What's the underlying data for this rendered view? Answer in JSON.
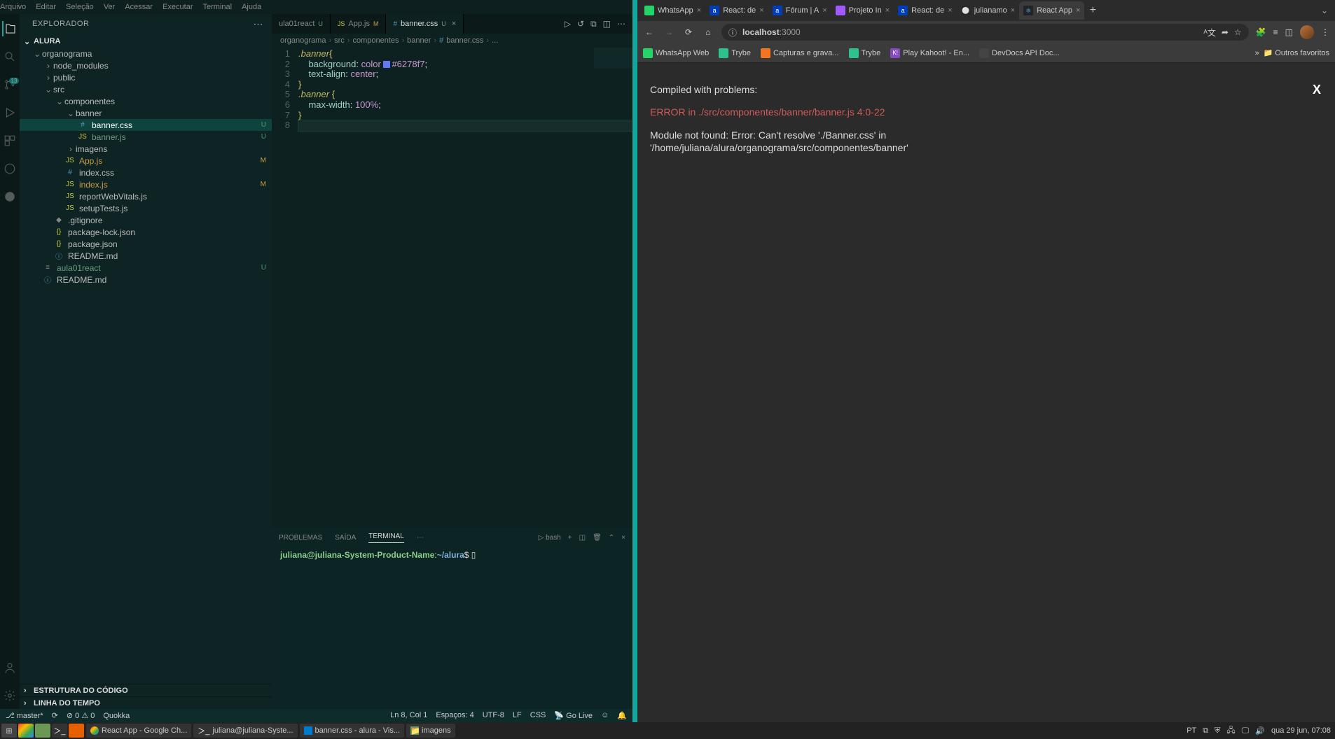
{
  "menubar": [
    "Arquivo",
    "Editar",
    "Seleção",
    "Ver",
    "Acessar",
    "Executar",
    "Terminal",
    "Ajuda"
  ],
  "sidebar": {
    "title": "EXPLORADOR",
    "root": "ALURA",
    "outline": "ESTRUTURA DO CÓDIGO",
    "timeline": "LINHA DO TEMPO"
  },
  "tree": {
    "organograma": "organograma",
    "node_modules": "node_modules",
    "public": "public",
    "src": "src",
    "componentes": "componentes",
    "banner": "banner",
    "bannercss": "banner.css",
    "bannerjs": "banner.js",
    "imagens": "imagens",
    "appjs": "App.js",
    "indexcss": "index.css",
    "indexjs": "index.js",
    "reportweb": "reportWebVitals.js",
    "setuptests": "setupTests.js",
    "gitignore": ".gitignore",
    "packlock": "package-lock.json",
    "packjson": "package.json",
    "readme1": "README.md",
    "aula01": "aula01react",
    "readme2": "README.md"
  },
  "tabs": {
    "t1": {
      "label": "ula01react",
      "badge": "U"
    },
    "t2": {
      "label": "App.js",
      "badge": "M"
    },
    "t3": {
      "label": "banner.css",
      "badge": "U"
    }
  },
  "breadcrumb": [
    "organograma",
    "src",
    "componentes",
    "banner",
    "banner.css",
    "..."
  ],
  "code": {
    "l1_sel": ".banner",
    "l2_prop": "background",
    "l2_col": "color",
    "l2_hex": "#6278f7",
    "l3_prop": "text-align",
    "l3_val": "center",
    "l5_sel": ".banner",
    "l6_prop": "max-width",
    "l6_val": "100%"
  },
  "lines": [
    "1",
    "2",
    "3",
    "4",
    "5",
    "6",
    "7",
    "8"
  ],
  "panel": {
    "problemas": "PROBLEMAS",
    "saida": "SAÍDA",
    "terminal": "TERMINAL",
    "shell": "bash"
  },
  "terminal": {
    "user": "juliana@juliana-System-Product-Name",
    "path": "~/alura"
  },
  "status": {
    "branch": "master*",
    "sync": "⟳",
    "errors": "0",
    "warnings": "0",
    "quokka": "Quokka",
    "pos": "Ln 8, Col 1",
    "spaces": "Espaços: 4",
    "enc": "UTF-8",
    "eol": "LF",
    "lang": "CSS",
    "golive": "Go Live"
  },
  "browserTabs": [
    {
      "label": "WhatsApp",
      "fcolor": "#25d366"
    },
    {
      "label": "React: de",
      "fcolor": "#003eb8"
    },
    {
      "label": "Fórum | A",
      "fcolor": "#003eb8"
    },
    {
      "label": "Projeto In",
      "fcolor": "#a259ff"
    },
    {
      "label": "React: de",
      "fcolor": "#003eb8"
    },
    {
      "label": "julianamo",
      "fcolor": "#fff"
    },
    {
      "label": "React App",
      "fcolor": "#61dafb",
      "active": true
    }
  ],
  "addr": {
    "host": "localhost",
    "port": ":3000"
  },
  "bookmarks": [
    {
      "label": "WhatsApp Web",
      "c": "#25d366"
    },
    {
      "label": "Trybe",
      "c": "#2fc18c"
    },
    {
      "label": "Capturas e grava...",
      "c": "#f47421"
    },
    {
      "label": "Trybe",
      "c": "#2fc18c"
    },
    {
      "label": "Play Kahoot! - En...",
      "c": "#864cbf"
    },
    {
      "label": "DevDocs API Doc...",
      "c": "#888"
    }
  ],
  "bookmarkRight": "Outros favoritos",
  "page": {
    "title": "Compiled with problems:",
    "error": "ERROR in ./src/componentes/banner/banner.js 4:0-22",
    "body1": "Module not found: Error: Can't resolve './Banner.css' in",
    "body2": "'/home/juliana/alura/organograma/src/componentes/banner'",
    "close": "X"
  },
  "os": {
    "tasks": [
      {
        "label": "React App - Google Ch...",
        "c": "#e74c3c"
      },
      {
        "label": "juliana@juliana-Syste...",
        "c": "#333"
      },
      {
        "label": "banner.css - alura - Vis...",
        "c": "#007acc"
      },
      {
        "label": "imagens",
        "c": "#6a9955"
      }
    ],
    "lang": "PT",
    "clock": "qua 29 jun, 07:08"
  }
}
